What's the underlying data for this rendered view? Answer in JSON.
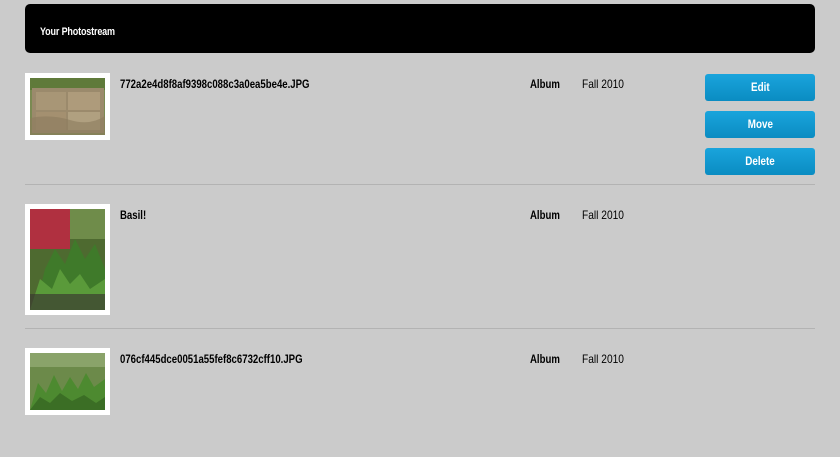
{
  "header": {
    "title": "Your Photostream"
  },
  "photos": [
    {
      "name": "772a2e4d8f8af9398c088c3a0ea5be4e.JPG",
      "album_label": "Album",
      "album": "Fall 2010"
    },
    {
      "name": "Basil!",
      "album_label": "Album",
      "album": "Fall 2010"
    },
    {
      "name": "076cf445dce0051a55fef8c6732cff10.JPG",
      "album_label": "Album",
      "album": "Fall 2010"
    }
  ],
  "actions": {
    "edit": "Edit",
    "move": "Move",
    "delete": "Delete"
  },
  "colors": {
    "background": "#cbcbcb",
    "header": "#000000",
    "button": "#0a9bd4"
  }
}
